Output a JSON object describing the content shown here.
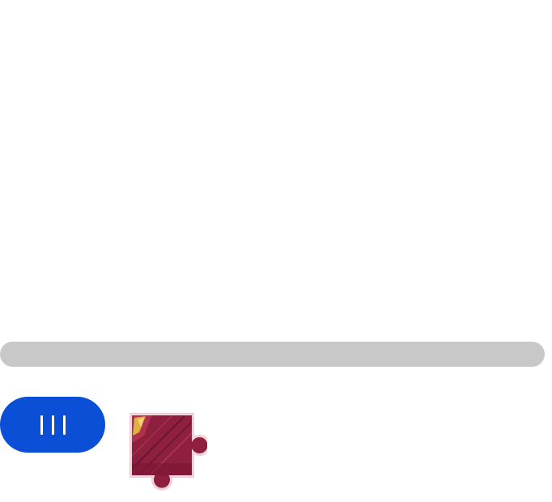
{
  "captcha": {
    "slider": {
      "track_color": "#c8c8c8",
      "handle_color": "#0a4fd6",
      "handle_icon": "grip-lines-icon",
      "progress": 0
    },
    "piece": {
      "icon": "puzzle-piece-icon",
      "fill_color": "#8e1f3e",
      "outline_color": "#f0c8d4"
    }
  }
}
